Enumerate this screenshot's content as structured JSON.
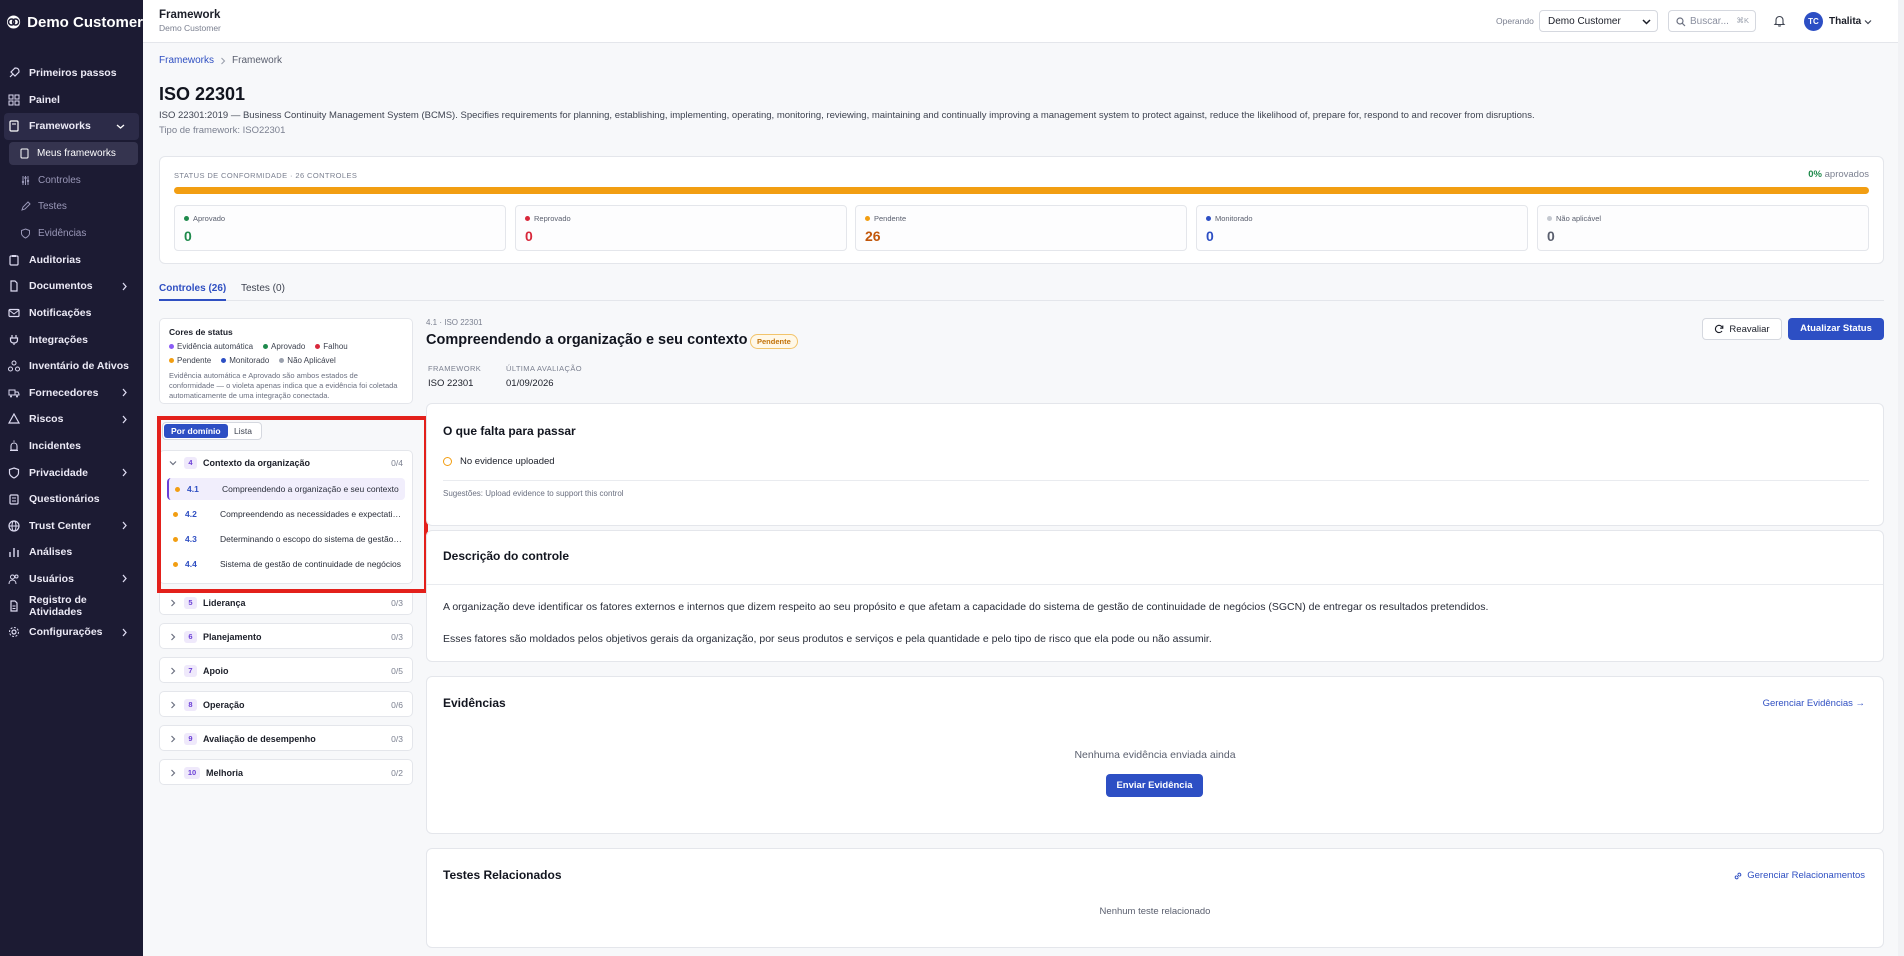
{
  "brand": {
    "name": "Demo Customer"
  },
  "sidebar": {
    "items": [
      {
        "label": "Primeiros passos",
        "icon": "rocket-icon"
      },
      {
        "label": "Painel",
        "icon": "dashboard-icon"
      },
      {
        "label": "Frameworks",
        "icon": "book-icon",
        "active": true
      },
      {
        "label": "Auditorias",
        "icon": "clipboard-icon"
      },
      {
        "label": "Documentos",
        "icon": "document-icon"
      },
      {
        "label": "Notificações",
        "icon": "mail-icon"
      },
      {
        "label": "Integrações",
        "icon": "plug-icon"
      },
      {
        "label": "Inventário de Ativos",
        "icon": "assets-icon"
      },
      {
        "label": "Fornecedores",
        "icon": "truck-icon"
      },
      {
        "label": "Riscos",
        "icon": "risk-icon"
      },
      {
        "label": "Incidentes",
        "icon": "siren-icon"
      },
      {
        "label": "Privacidade",
        "icon": "shield-icon"
      },
      {
        "label": "Questionários",
        "icon": "clipboard-list-icon"
      },
      {
        "label": "Trust Center",
        "icon": "globe-icon"
      },
      {
        "label": "Análises",
        "icon": "bar-chart-icon"
      },
      {
        "label": "Usuários",
        "icon": "users-icon"
      },
      {
        "label": "Registro de Atividades",
        "icon": "activity-log-icon"
      },
      {
        "label": "Configurações",
        "icon": "gear-icon"
      }
    ],
    "sub": [
      {
        "label": "Meus frameworks",
        "icon": "book-icon"
      },
      {
        "label": "Controles",
        "icon": "sliders-icon"
      },
      {
        "label": "Testes",
        "icon": "pencil-icon"
      },
      {
        "label": "Evidências",
        "icon": "shield-outline-icon"
      }
    ]
  },
  "topbar": {
    "title": "Framework",
    "subtitle": "Demo Customer",
    "operando_label": "Operando",
    "operando_value": "Demo Customer",
    "search_placeholder": "Buscar...",
    "search_shortcut": "⌘K",
    "avatar_initials": "TC",
    "user_name": "Thalita"
  },
  "breadcrumb": {
    "root": "Frameworks",
    "current": "Framework"
  },
  "framework": {
    "title": "ISO 22301",
    "description": "ISO 22301:2019 — Business Continuity Management System (BCMS). Specifies requirements for planning, establishing, implementing, operating, monitoring, reviewing, maintaining and continually improving a management system to protect against, reduce the likelihood of, prepare for, respond to and recover from disruptions.",
    "type_line": "Tipo de framework: ISO22301"
  },
  "compliance": {
    "heading": "STATUS DE CONFORMIDADE · 26 CONTROLES",
    "approved_pct": "0%",
    "approved_label": "aprovados",
    "pending_fraction": 1.0,
    "colors": {
      "pending": "#f29e12",
      "approved": "#1f8a4c",
      "failed": "#d8283b",
      "monitored": "#2d4fc4",
      "na": "#9aa0ad"
    },
    "stats": [
      {
        "label": "Aprovado",
        "value": "0",
        "color": "#1f8a4c"
      },
      {
        "label": "Reprovado",
        "value": "0",
        "color": "#d8283b"
      },
      {
        "label": "Pendente",
        "value": "26",
        "color": "#c2570b"
      },
      {
        "label": "Monitorado",
        "value": "0",
        "color": "#2d4fc4"
      },
      {
        "label": "Não aplicável",
        "value": "0",
        "color": "#5a5f6e"
      }
    ]
  },
  "tabs": {
    "controls": "Controles (26)",
    "tests": "Testes (0)"
  },
  "legend": {
    "title": "Cores de status",
    "items": [
      "Evidência automática",
      "Aprovado",
      "Falhou",
      "Pendente",
      "Monitorado",
      "Não Aplicável"
    ],
    "note": "Evidência automática e Aprovado são ambos estados de conformidade — o violeta apenas indica que a evidência foi coletada automaticamente de uma integração conectada."
  },
  "view_toggle": {
    "by_domain": "Por domínio",
    "list": "Lista"
  },
  "domains": [
    {
      "num": "4",
      "name": "Contexto da organização",
      "count": "0/4",
      "controls": [
        {
          "code": "4.1",
          "name": "Compreendendo a organização e seu contexto"
        },
        {
          "code": "4.2",
          "name": "Compreendendo as necessidades e expectativas das partes interessadas"
        },
        {
          "code": "4.3",
          "name": "Determinando o escopo do sistema de gestão de continuidade de negócios"
        },
        {
          "code": "4.4",
          "name": "Sistema de gestão de continuidade de negócios"
        }
      ]
    },
    {
      "num": "5",
      "name": "Liderança",
      "count": "0/3"
    },
    {
      "num": "6",
      "name": "Planejamento",
      "count": "0/3"
    },
    {
      "num": "7",
      "name": "Apoio",
      "count": "0/5"
    },
    {
      "num": "8",
      "name": "Operação",
      "count": "0/6"
    },
    {
      "num": "9",
      "name": "Avaliação de desempenho",
      "count": "0/3"
    },
    {
      "num": "10",
      "name": "Melhoria",
      "count": "0/2"
    }
  ],
  "control": {
    "meta": "4.1 · ISO 22301",
    "title": "Compreendendo a organização e seu contexto",
    "status": "Pendente",
    "reval_label": "Reavaliar",
    "update_label": "Atualizar Status",
    "framework_label": "FRAMEWORK",
    "framework_value": "ISO 22301",
    "last_eval_label": "ÚLTIMA AVALIAÇÃO",
    "last_eval_value": "01/09/2026"
  },
  "missing": {
    "title": "O que falta para passar",
    "item": "No evidence uploaded",
    "suggestion": "Sugestões: Upload evidence to support this control"
  },
  "description_card": {
    "title": "Descrição do controle",
    "p1": "A organização deve identificar os fatores externos e internos que dizem respeito ao seu propósito e que afetam a capacidade do sistema de gestão de continuidade de negócios (SGCN) de entregar os resultados pretendidos.",
    "p2": "Esses fatores são moldados pelos objetivos gerais da organização, por seus produtos e serviços e pela quantidade e pelo tipo de risco que ela pode ou não assumir."
  },
  "evidence": {
    "title": "Evidências",
    "manage_link": "Gerenciar Evidências →",
    "empty": "Nenhuma evidência enviada ainda",
    "send_button": "Enviar Evidência"
  },
  "related_tests": {
    "title": "Testes Relacionados",
    "manage_link": "Gerenciar Relacionamentos",
    "empty": "Nenhum teste relacionado"
  }
}
